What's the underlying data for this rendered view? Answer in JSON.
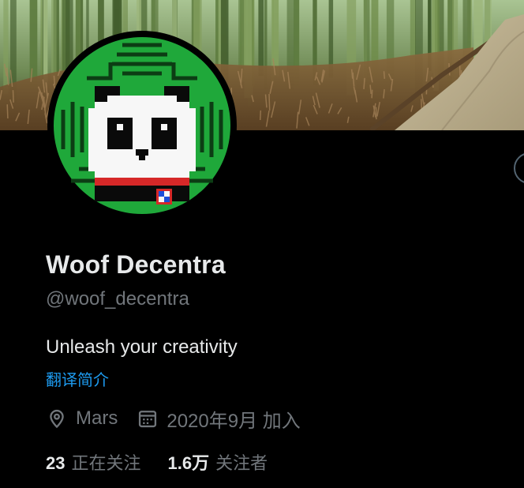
{
  "profile": {
    "display_name": "Woof Decentra",
    "handle": "@woof_decentra",
    "bio": "Unleash your creativity",
    "translate_label": "翻译简介",
    "location": "Mars",
    "joined": "2020年9月 加入"
  },
  "stats": {
    "following_count": "23",
    "following_label": "正在关注",
    "followers_count": "1.6万",
    "followers_label": "关注者"
  },
  "icons": {
    "location": "map-pin-icon",
    "joined": "calendar-icon",
    "more": "more-options-icon"
  },
  "colors": {
    "background": "#000000",
    "primary_text": "#e7e9ea",
    "secondary_text": "#71767b",
    "link": "#1d9bf0",
    "avatar_green": "#1fa83a"
  }
}
